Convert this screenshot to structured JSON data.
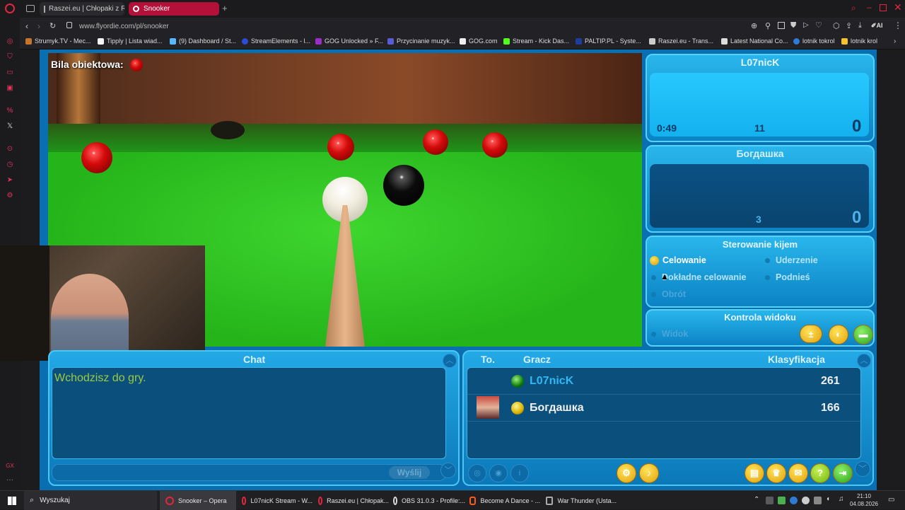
{
  "browser": {
    "tabs": [
      {
        "label": "Raszei.eu | Chłopaki z Ras",
        "active": false
      },
      {
        "label": "Snooker",
        "active": true
      }
    ],
    "address": "www.flyordie.com/pl/snooker",
    "bookmarks": [
      "Strumyk.TV - Mec...",
      "Tipply | Lista wiad...",
      "(9) Dashboard / St...",
      "StreamElements - l...",
      "GOG Unlocked » F...",
      "Przycinanie muzyk...",
      "GOG.com",
      "Stream - Kick Das...",
      "PALTIP.PL - Syste...",
      "Raszei.eu - Trans...",
      "Latest National Co...",
      "lotnik tokrol",
      "lotnik krol"
    ],
    "ai_label": "AI"
  },
  "game": {
    "object_ball_label": "Bila obiektowa:",
    "player1": {
      "name": "L07nicK",
      "timer": "0:49",
      "break": "11",
      "score": "0"
    },
    "player2": {
      "name": "Богдашка",
      "break": "3",
      "score": "0"
    },
    "cue_control": {
      "title": "Sterowanie kijem",
      "items": [
        "Celowanie",
        "Uderzenie",
        "Dokładne celowanie",
        "Podnieś",
        "Obrót"
      ],
      "selected": "Celowanie"
    },
    "view_control": {
      "title": "Kontrola widoku",
      "item": "Widok"
    },
    "chat": {
      "title": "Chat",
      "message": "Wchodzisz do gry.",
      "send_label": "Wyślij"
    },
    "players_table": {
      "headers": [
        "To.",
        "Gracz",
        "Klasyfikacja"
      ],
      "rows": [
        {
          "name": "L07nicK",
          "rating": "261",
          "ball": "green"
        },
        {
          "name": "Богдашка",
          "rating": "166",
          "ball": "yellow"
        }
      ]
    }
  },
  "taskbar": {
    "search": "Wyszukaj",
    "apps": [
      "Snooker – Opera",
      "L07nicK Stream - W...",
      "Raszei.eu | Chłopak...",
      "OBS 31.0.3 - Profile:...",
      "Become A Dance - ...",
      "War Thunder (Usta..."
    ],
    "time": "21:10",
    "date": "04.08.2026"
  },
  "colors": {
    "accent": "#e2273f",
    "panel": "#0a6fb0",
    "felt": "#25b51a"
  }
}
